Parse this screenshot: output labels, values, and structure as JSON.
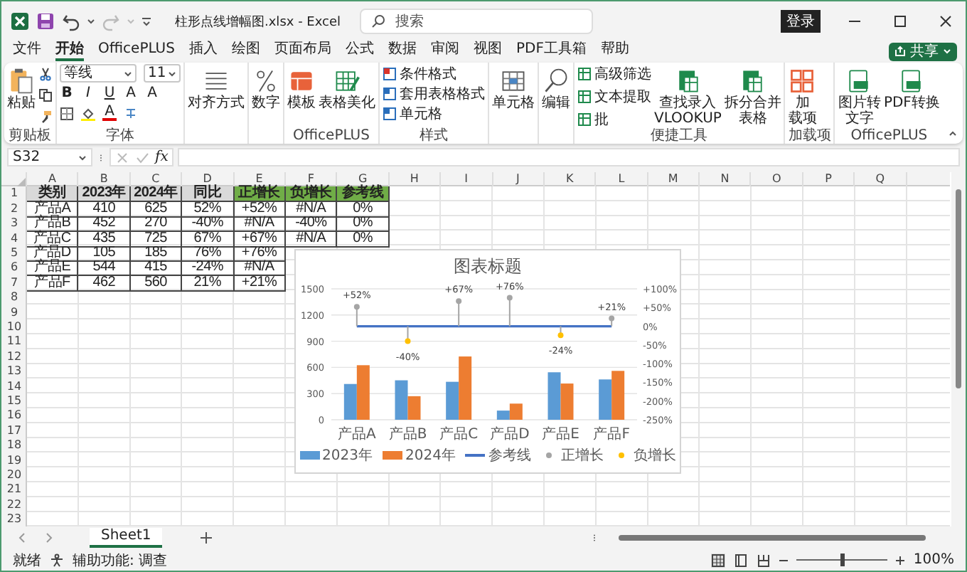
{
  "title_bar": {
    "title": "柱形点线增幅图.xlsx  -  Excel",
    "search": {
      "placeholder": "搜索"
    },
    "login": "登录"
  },
  "menu": {
    "tabs": [
      {
        "label": "文件",
        "selected": false
      },
      {
        "label": "开始",
        "selected": true
      },
      {
        "label": "OfficePLUS",
        "selected": false
      },
      {
        "label": "插入",
        "selected": false
      },
      {
        "label": "绘图",
        "selected": false
      },
      {
        "label": "页面布局",
        "selected": false
      },
      {
        "label": "公式",
        "selected": false
      },
      {
        "label": "数据",
        "selected": false
      },
      {
        "label": "审阅",
        "selected": false
      },
      {
        "label": "视图",
        "selected": false
      },
      {
        "label": "PDF工具箱",
        "selected": false
      },
      {
        "label": "帮助",
        "selected": false
      }
    ],
    "share": "共享"
  },
  "ribbon": {
    "clipboard": {
      "paste": "粘贴",
      "label": "剪贴板"
    },
    "font": {
      "name": "等线",
      "size": "11",
      "bold": "B",
      "italic": "I",
      "underline": "U",
      "grow": "A",
      "shrink": "A",
      "color_letter": "A",
      "label": "字体"
    },
    "align": "对齐方式",
    "number": "数字",
    "officeplus": {
      "items": [
        "模板",
        "表格美化"
      ],
      "label": "OfficePLUS"
    },
    "styles": {
      "items": [
        "条件格式",
        "套用表格格式",
        "单元格"
      ],
      "label": "样式"
    },
    "cells": "单元格",
    "editing": "编辑",
    "tools": {
      "small": [
        "高级筛选",
        "文本提取",
        "批"
      ],
      "large": [
        [
          "查找录入",
          "VLOOKUP"
        ],
        [
          "拆分合并",
          "表格"
        ]
      ],
      "label": "便捷工具"
    },
    "addins": {
      "lines": [
        "加",
        "载项"
      ],
      "label": "加载项"
    },
    "officeplus2": {
      "items": [
        [
          "图片转",
          "文字"
        ],
        [
          "PDF转换"
        ]
      ],
      "label": "OfficePLUS"
    }
  },
  "formula_bar": {
    "name_box": "S32",
    "fx": "fx"
  },
  "sheet": {
    "columns": [
      "A",
      "B",
      "C",
      "D",
      "E",
      "F",
      "G",
      "H",
      "I",
      "J",
      "K",
      "L",
      "M",
      "N",
      "O",
      "P",
      "Q"
    ],
    "rows": [
      {
        "number": "1",
        "kind": "header",
        "cells": [
          {
            "text": "类别",
            "color": "#d9d9d9"
          },
          {
            "text": "2023年",
            "color": "#d9d9d9"
          },
          {
            "text": "2024年",
            "color": "#d9d9d9"
          },
          {
            "text": "同比",
            "color": "#d9d9d9"
          },
          {
            "text": "正增长",
            "color": "#70ad47"
          },
          {
            "text": "负增长",
            "color": "#70ad47"
          },
          {
            "text": "参考线",
            "color": "#70ad47"
          }
        ]
      },
      {
        "number": "2",
        "kind": "data",
        "cells": [
          {
            "text": "产品A"
          },
          {
            "text": "410"
          },
          {
            "text": "625"
          },
          {
            "text": "52%"
          },
          {
            "text": "+52%"
          },
          {
            "text": "#N/A"
          },
          {
            "text": "0%"
          }
        ]
      },
      {
        "number": "3",
        "kind": "data",
        "cells": [
          {
            "text": "产品B"
          },
          {
            "text": "452"
          },
          {
            "text": "270"
          },
          {
            "text": "-40%"
          },
          {
            "text": "#N/A"
          },
          {
            "text": "-40%"
          },
          {
            "text": "0%"
          }
        ]
      },
      {
        "number": "4",
        "kind": "data",
        "cells": [
          {
            "text": "产品C"
          },
          {
            "text": "435"
          },
          {
            "text": "725"
          },
          {
            "text": "67%"
          },
          {
            "text": "+67%"
          },
          {
            "text": "#N/A"
          },
          {
            "text": "0%"
          }
        ]
      },
      {
        "number": "5",
        "kind": "data",
        "cells": [
          {
            "text": "产品D"
          },
          {
            "text": "105"
          },
          {
            "text": "185"
          },
          {
            "text": "76%"
          },
          {
            "text": "+76%"
          }
        ]
      },
      {
        "number": "6",
        "kind": "data",
        "cells": [
          {
            "text": "产品E"
          },
          {
            "text": "544"
          },
          {
            "text": "415"
          },
          {
            "text": "-24%"
          },
          {
            "text": "#N/A"
          }
        ]
      },
      {
        "number": "7",
        "kind": "data",
        "cells": [
          {
            "text": "产品F"
          },
          {
            "text": "462"
          },
          {
            "text": "560"
          },
          {
            "text": "21%"
          },
          {
            "text": "+21%"
          }
        ]
      },
      {
        "number": "8"
      },
      {
        "number": "9"
      },
      {
        "number": "10"
      },
      {
        "number": "11"
      },
      {
        "number": "12"
      },
      {
        "number": "13"
      },
      {
        "number": "14"
      },
      {
        "number": "15"
      },
      {
        "number": "16"
      },
      {
        "number": "17"
      },
      {
        "number": "18"
      },
      {
        "number": "19"
      },
      {
        "number": "20"
      },
      {
        "number": "21"
      },
      {
        "number": "22"
      },
      {
        "number": "23"
      }
    ],
    "chart": {
      "chart_data": {
        "type": "bar",
        "title": "图表标题",
        "categories": [
          "产品A",
          "产品B",
          "产品C",
          "产品D",
          "产品E",
          "产品F"
        ],
        "series": [
          {
            "name": "2023年",
            "color": "#5b9bd5",
            "type": "bar",
            "values": [
              410,
              452,
              435,
              105,
              544,
              462
            ]
          },
          {
            "name": "2024年",
            "color": "#ed7d31",
            "type": "bar",
            "values": [
              625,
              270,
              725,
              185,
              415,
              560
            ]
          },
          {
            "name": "参考线",
            "color": "#4472c4",
            "type": "line",
            "axis": "y2",
            "values": [
              0,
              0,
              0,
              0,
              0,
              0
            ]
          },
          {
            "name": "正增长",
            "color": "#a5a5a5",
            "type": "scatter",
            "axis": "y2",
            "values": [
              52,
              null,
              67,
              76,
              null,
              21
            ]
          },
          {
            "name": "负增长",
            "color": "#ffc000",
            "type": "scatter",
            "axis": "y2",
            "values": [
              null,
              -40,
              null,
              null,
              -24,
              null
            ]
          }
        ],
        "grid": true,
        "legend": "bottom",
        "annotations": [
          "+52%",
          "-40%",
          "+67%",
          "+76%",
          "-24%",
          "+21%"
        ],
        "ylim": [
          0,
          1500
        ],
        "yticks": [
          0,
          300,
          600,
          900,
          1200,
          1500
        ],
        "y2lim": [
          -250,
          100
        ],
        "y2ticks": [
          {
            "value": 100,
            "label": "+100%"
          },
          {
            "value": 50,
            "label": "+50%"
          },
          {
            "value": 0,
            "label": "0%"
          },
          {
            "value": -50,
            "label": "-50%"
          },
          {
            "value": -100,
            "label": "-100%"
          },
          {
            "value": -150,
            "label": "-150%"
          },
          {
            "value": -200,
            "label": "-200%"
          },
          {
            "value": -250,
            "label": "-250%"
          }
        ]
      }
    }
  },
  "sheet_tabs": [
    {
      "label": "Sheet1",
      "selected": true
    }
  ],
  "status_bar": {
    "ready": "就绪",
    "accessibility": "辅助功能: 调查",
    "zoom": {
      "level": 0.5,
      "reading": "100%"
    }
  }
}
